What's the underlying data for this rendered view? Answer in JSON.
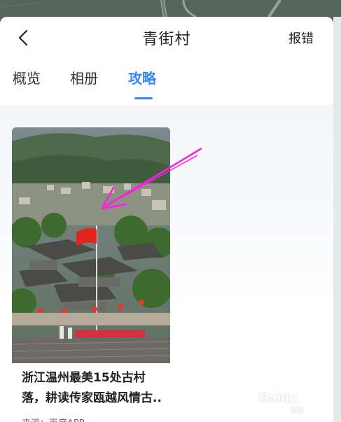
{
  "header": {
    "back_icon": "chevron-left-icon",
    "title": "青街村",
    "report_label": "报错"
  },
  "tabs": [
    {
      "label": "概览",
      "active": false
    },
    {
      "label": "相册",
      "active": false
    },
    {
      "label": "攻略",
      "active": true
    }
  ],
  "colors": {
    "accent": "#3385ff",
    "annotation_arrow": "#ff1de6"
  },
  "guide_cards": [
    {
      "title": "浙江温州最美15处古村落，耕读传家瓯越风情古..",
      "source": "来源：百度APP",
      "image": "village-photo-with-red-flag"
    }
  ],
  "watermark": {
    "brand": "Baidu",
    "sub": "经验"
  }
}
